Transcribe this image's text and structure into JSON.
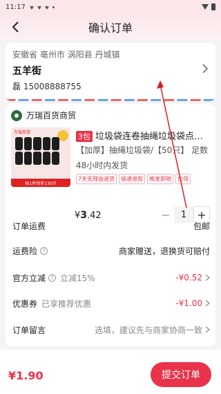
{
  "status_bar": {
    "time": "11:17"
  },
  "nav": {
    "title": "确认订单",
    "back_icon": "chevron-left-icon"
  },
  "address": {
    "region": "安徽省 亳州市 涡阳县 丹城镇",
    "street": "五羊街",
    "person": "磊 15008888755"
  },
  "shop": {
    "name": "万瑞百货商贸"
  },
  "product": {
    "badge": "3包",
    "title": "垃圾袋连卷抽绳垃圾袋点断式加厚",
    "spec": "【加厚】抽绳垃圾袋/【50只】 足数",
    "ship": "48小时内发货",
    "tags": [
      "7天无理由退货",
      "极速退款",
      "晚发即赔",
      "价保"
    ],
    "price_symbol": "¥",
    "price_int": "3",
    "price_dec": ".42",
    "quantity": "1",
    "image_text": {
      "banner": "拍1件到手130只",
      "brand": "万瑞百货"
    }
  },
  "rows": {
    "shipping": {
      "label": "订单运费",
      "value": "包邮"
    },
    "insurance": {
      "label": "运费险",
      "value": "商家赠送，退换货可赔付"
    },
    "official_discount": {
      "label": "官方立减",
      "sub": "立减15%",
      "value": "-¥0.52"
    },
    "coupon": {
      "label": "优惠券",
      "sub": "已享推荐优惠",
      "value": "-¥1.00"
    },
    "message": {
      "label": "订单留言",
      "placeholder": "选填，建议先与商家协商一致"
    }
  },
  "footer": {
    "total": "¥1.90",
    "submit_label": "提交订单"
  },
  "colors": {
    "accent": "#e8334a",
    "header_bg": "#fbe7ea"
  }
}
